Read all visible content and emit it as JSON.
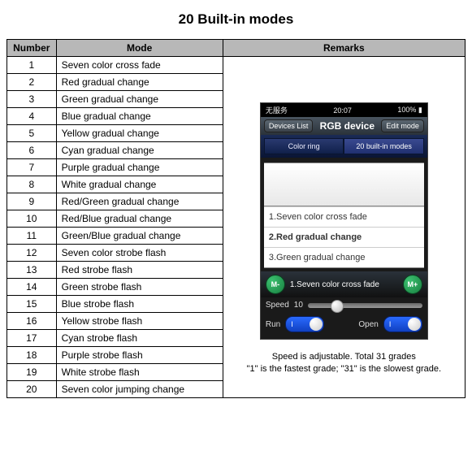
{
  "title": "20 Built-in modes",
  "table": {
    "headers": {
      "number": "Number",
      "mode": "Mode",
      "remarks": "Remarks"
    },
    "rows": [
      {
        "n": "1",
        "mode": "Seven color cross fade"
      },
      {
        "n": "2",
        "mode": "Red gradual change"
      },
      {
        "n": "3",
        "mode": "Green gradual change"
      },
      {
        "n": "4",
        "mode": "Blue gradual change"
      },
      {
        "n": "5",
        "mode": "Yellow gradual change"
      },
      {
        "n": "6",
        "mode": "Cyan gradual change"
      },
      {
        "n": "7",
        "mode": "Purple gradual change"
      },
      {
        "n": "8",
        "mode": "White gradual change"
      },
      {
        "n": "9",
        "mode": "Red/Green gradual change"
      },
      {
        "n": "10",
        "mode": "Red/Blue gradual change"
      },
      {
        "n": "11",
        "mode": "Green/Blue gradual change"
      },
      {
        "n": "12",
        "mode": "Seven color strobe flash"
      },
      {
        "n": "13",
        "mode": "Red strobe flash"
      },
      {
        "n": "14",
        "mode": "Green strobe flash"
      },
      {
        "n": "15",
        "mode": "Blue strobe flash"
      },
      {
        "n": "16",
        "mode": "Yellow strobe flash"
      },
      {
        "n": "17",
        "mode": "Cyan strobe flash"
      },
      {
        "n": "18",
        "mode": "Purple strobe flash"
      },
      {
        "n": "19",
        "mode": "White strobe flash"
      },
      {
        "n": "20",
        "mode": "Seven color jumping change"
      }
    ]
  },
  "phone": {
    "status_left": "无服务",
    "status_time": "20:07",
    "status_right": "100%",
    "nav_back": "Devices List",
    "nav_title": "RGB device",
    "nav_edit": "Edit mode",
    "seg_left": "Color ring",
    "seg_right": "20 built-in modes",
    "picker_item1": "1.Seven color cross fade",
    "picker_item2": "2.Red  gradual change",
    "picker_item3": "3.Green gradual change",
    "minus": "M-",
    "plus": "M+",
    "current": "1.Seven color cross fade",
    "speed_label": "Speed",
    "speed_value": "10",
    "run_label": "Run",
    "open_label": "Open",
    "toggle_text": "I"
  },
  "remarks": {
    "line1": "Speed is adjustable. Total 31 grades",
    "line2": "\"1\" is the fastest grade; \"31\" is the slowest grade."
  }
}
